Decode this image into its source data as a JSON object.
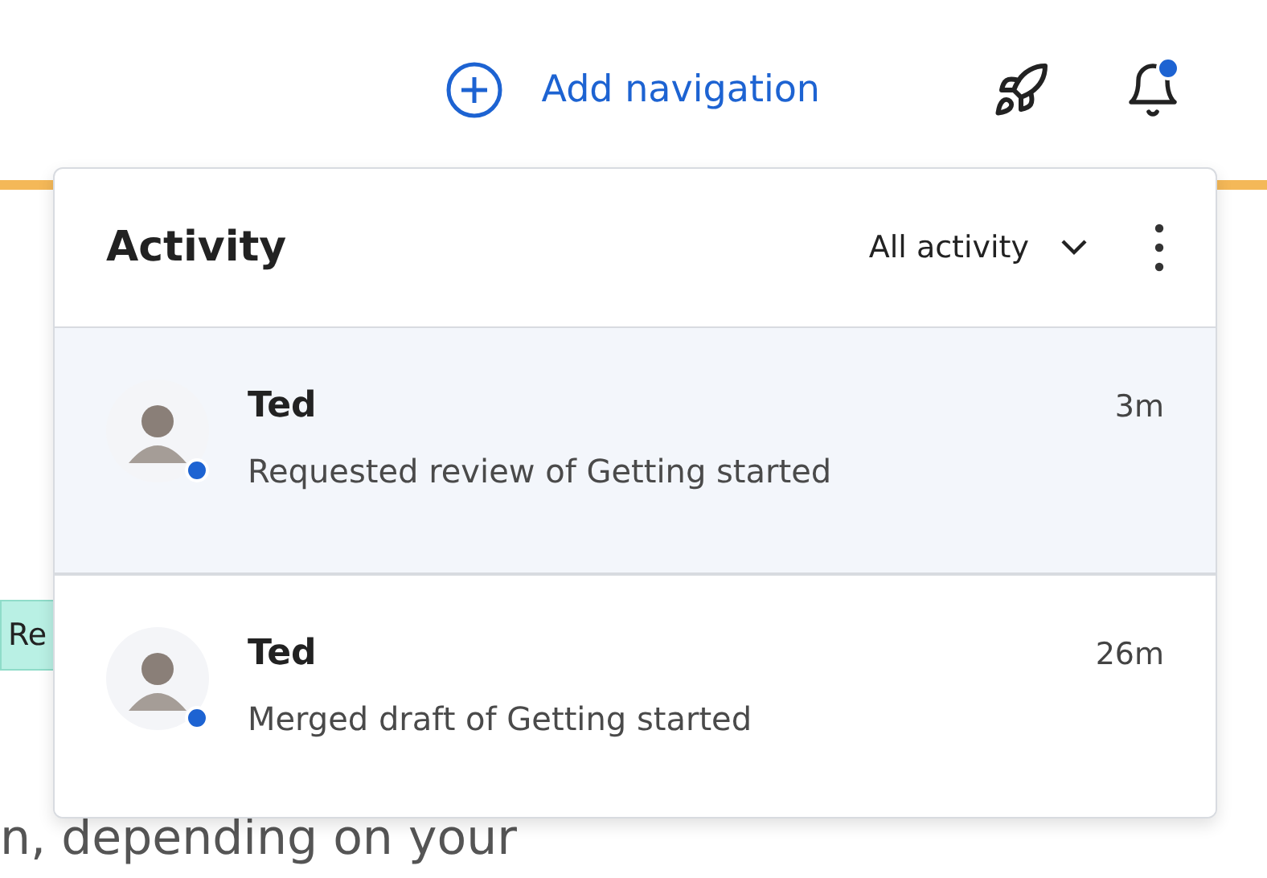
{
  "topbar": {
    "add_navigation": "Add navigation",
    "notifications_unread": true
  },
  "background": {
    "badge": "Re",
    "text": "n, depending on your"
  },
  "activity_panel": {
    "title": "Activity",
    "filter": "All activity",
    "items": [
      {
        "name": "Ted",
        "time": "3m",
        "message": "Requested review of Getting started",
        "selected": true,
        "online": true
      },
      {
        "name": "Ted",
        "time": "26m",
        "message": "Merged draft of Getting started",
        "selected": false,
        "online": true
      }
    ]
  }
}
